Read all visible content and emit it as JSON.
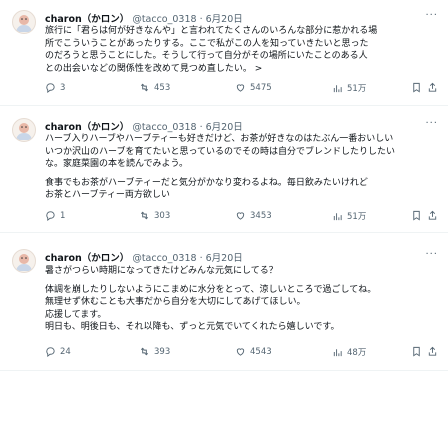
{
  "tweets": [
    {
      "name": "charon（かロン）",
      "handle": "@tacco_0318",
      "date": "6月20日",
      "more": "···",
      "lines": [
        "旅行に「君らは何が好きなんや」と言われてたくさんのいろんな部分に惹かれる場",
        "所でこういうことがあったりする。ここで私がこの人を知っていきたいと思った",
        "のだろうと思うことにした。そうして行って自分がその場所にいたことのある人",
        "との出会いなどの関係性を改めて見つめ直したい。 >"
      ],
      "reply": "3",
      "rt": "453",
      "like": "5475",
      "views": "51万"
    },
    {
      "name": "charon（かロン）",
      "handle": "@tacco_0318",
      "date": "6月20日",
      "more": "···",
      "lines": [
        "ハーブ入りハーブやハーブティーも好きだけど、お茶が好きなのはたぶん一番おいしい",
        "いつか沢山のハーブを育てたいと思っているのでその時は自分でブレンドしたりしたい",
        "な。家庭菜園の本を読んでみよう。"
      ],
      "lines2": [
        "食事でもお茶がハーブティーだと気分がかなり変わるよね。毎日飲みたいけれど",
        "お茶とハーブティー両方欲しい"
      ],
      "reply": "1",
      "rt": "303",
      "like": "3453",
      "views": "51万"
    },
    {
      "name": "charon（かロン）",
      "handle": "@tacco_0318",
      "date": "6月20日",
      "more": "···",
      "lines": [
        "暑さがつらい時期になってきたけどみんな元気にしてる？"
      ],
      "lines2": [
        "体調を崩したりしないようにこまめに水分をとって、涼しいところで過ごしてね。",
        "無理せず休むことも大事だから自分を大切にしてあげてほしい。",
        "応援してます。",
        "明日も、明後日も、それ以降も、ずっと元気でいてくれたら嬉しいです。"
      ],
      "reply": "24",
      "rt": "393",
      "like": "4543",
      "views": "48万"
    }
  ],
  "icons": [
    "avatar-icon",
    "reply-icon",
    "retweet-icon",
    "like-icon",
    "views-icon",
    "bookmark-icon",
    "share-icon"
  ],
  "colors": {
    "text": "#0f1419",
    "muted": "#536471",
    "separator": "#eff3f4"
  }
}
